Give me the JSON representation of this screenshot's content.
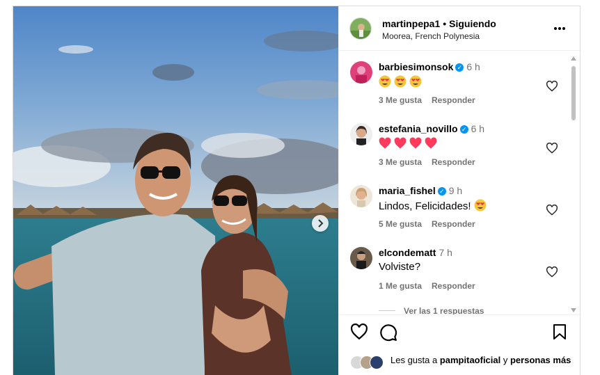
{
  "post": {
    "username": "martinpepa1",
    "separator": "•",
    "follow_state": "Siguiendo",
    "location": "Moorea, French Polynesia",
    "more_icon": "more-options-icon"
  },
  "comments": [
    {
      "username": "barbiesimonsok",
      "verified": true,
      "time": "6 h",
      "text": "",
      "emojis": [
        "heart-eyes",
        "heart-eyes",
        "heart-eyes"
      ],
      "likes": "3 Me gusta",
      "reply": "Responder"
    },
    {
      "username": "estefania_novillo",
      "verified": true,
      "time": "6 h",
      "text": "",
      "emojis": [
        "heart",
        "heart",
        "heart",
        "heart"
      ],
      "likes": "3 Me gusta",
      "reply": "Responder"
    },
    {
      "username": "maria_fishel",
      "verified": true,
      "time": "9 h",
      "text": "Lindos, Felicidades!",
      "emojis": [
        "heart-eyes"
      ],
      "likes": "5 Me gusta",
      "reply": "Responder"
    },
    {
      "username": "elcondematt",
      "verified": false,
      "time": "7 h",
      "text": "Volviste?",
      "emojis": [],
      "likes": "1 Me gusta",
      "reply": "Responder"
    }
  ],
  "view_replies": "Ver las 1 respuestas",
  "likes_summary": {
    "prefix": "Les gusta a ",
    "user": "pampitaoficial",
    "connector": " y ",
    "rest": "personas más"
  },
  "colors": {
    "verified": "#0095f6",
    "heart": "#ff3040",
    "meta": "#737373"
  }
}
